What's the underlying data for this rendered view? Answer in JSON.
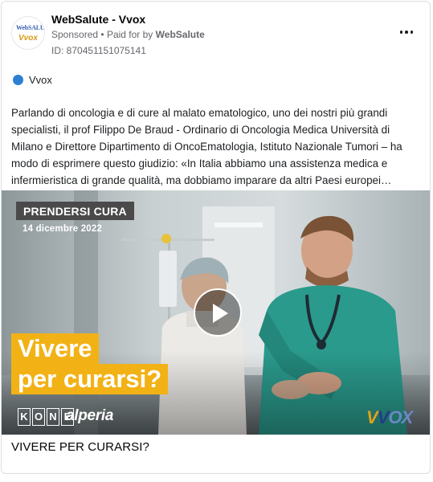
{
  "post": {
    "page_name": "WebSalute - Vvox",
    "sponsored": "Sponsored",
    "separator": "•",
    "paid_for_prefix": "Paid for by",
    "payer": "WebSalute",
    "ad_id": "ID: 870451151075141",
    "more_icon": "more-horizontal-icon"
  },
  "avatar": {
    "line1": "WebSALUTE",
    "line2": "Vvox"
  },
  "platform": {
    "label": "Vvox",
    "dot_color": "#2d7fd1"
  },
  "body_text": "Parlando di oncologia e di cure al malato ematologico, uno dei nostri più grandi specialisti, il prof Filippo De Braud - Ordinario di Oncologia Medica Università di Milano e Direttore Dipartimento di OncoEmatologia, Istituto Nazionale Tumori – ha modo di esprimere questo giudizio: «In Italia abbiamo una assistenza medica e infermieristica di grande qualità, ma dobbiamo imparare da altri Paesi europei…",
  "media": {
    "tag": "PRENDERSI CURA",
    "date": "14 dicembre 2022",
    "headline_line1": "Vivere",
    "headline_line2": "per curarsi?",
    "sponsor1_letters": [
      "K",
      "O",
      "N",
      "E"
    ],
    "sponsor2": "alperia",
    "brand_mark": "Vvox",
    "accent_color": "#f2b215",
    "play_icon": "play-icon"
  },
  "caption": "VIVERE PER CURARSI?"
}
